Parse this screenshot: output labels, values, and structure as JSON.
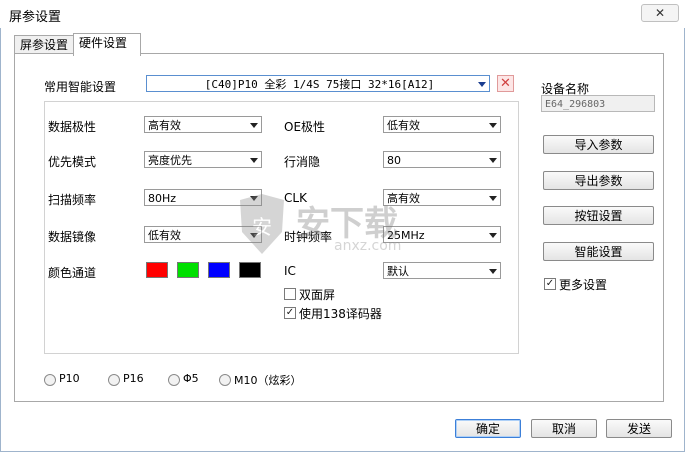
{
  "window": {
    "title": "屏参设置",
    "close_symbol": "✕"
  },
  "tabs": [
    {
      "label": "屏参设置"
    },
    {
      "label": "硬件设置"
    }
  ],
  "common_setting": {
    "label": "常用智能设置",
    "value": "[C40]P10  全彩 1/4S  75接口 32*16[A12]",
    "delete_symbol": "✕"
  },
  "device": {
    "label": "设备名称",
    "value": "E64_296803"
  },
  "params": {
    "data_polarity": {
      "label": "数据极性",
      "value": "高有效"
    },
    "oe_polarity": {
      "label": "OE极性",
      "value": "低有效"
    },
    "priority_mode": {
      "label": "优先模式",
      "value": "亮度优先"
    },
    "line_blanking": {
      "label": "行消隐",
      "value": "80"
    },
    "scan_freq": {
      "label": "扫描频率",
      "value": "80Hz"
    },
    "clk": {
      "label": "CLK",
      "value": "高有效"
    },
    "data_mirror": {
      "label": "数据镜像",
      "value": "低有效"
    },
    "clock_freq": {
      "label": "时钟频率",
      "value": "25MHz"
    },
    "color_channel": {
      "label": "颜色通道",
      "colors": [
        "#ff0000",
        "#00e000",
        "#0000ff",
        "#000000"
      ]
    },
    "ic": {
      "label": "IC",
      "value": "默认"
    }
  },
  "checks": {
    "double_side": {
      "label": "双面屏",
      "checked": false
    },
    "decoder_138": {
      "label": "使用138译码器",
      "checked": true
    },
    "more_settings": {
      "label": "更多设置",
      "checked": true
    }
  },
  "side_buttons": {
    "import": "导入参数",
    "export": "导出参数",
    "button_settings": "按钮设置",
    "smart_settings": "智能设置"
  },
  "radios": [
    {
      "label": "P10"
    },
    {
      "label": "P16"
    },
    {
      "label": "Φ5"
    },
    {
      "label": "M10（炫彩）"
    }
  ],
  "footer": {
    "ok": "确定",
    "cancel": "取消",
    "send": "发送"
  },
  "watermark": {
    "text": "安下载",
    "sub": "anxz.com"
  }
}
